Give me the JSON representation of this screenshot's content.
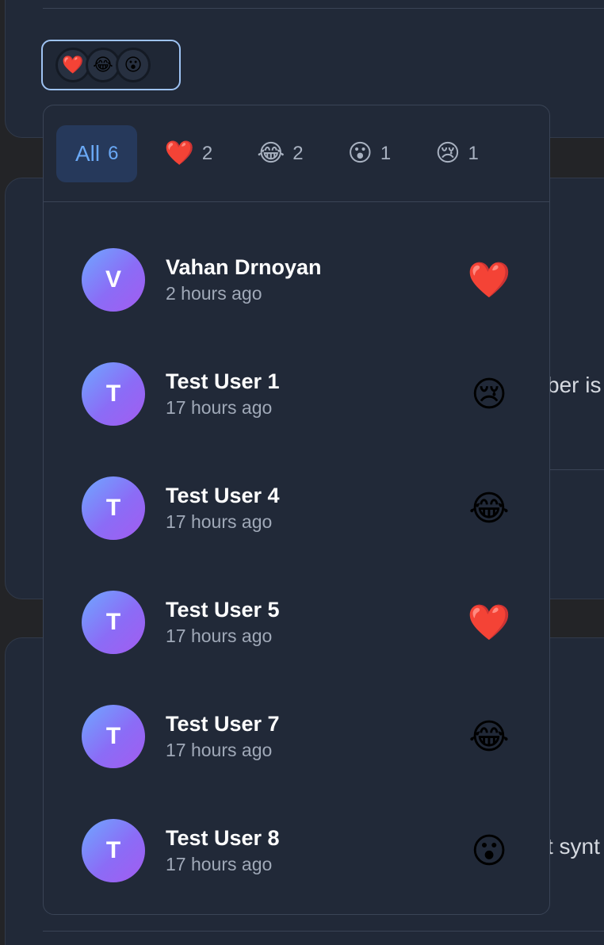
{
  "reaction_pill": {
    "emojis": [
      "❤️",
      "😂",
      "😮"
    ]
  },
  "tabs": [
    {
      "label": "All",
      "count": "6",
      "active": true
    },
    {
      "emoji": "❤️",
      "count": "2",
      "active": false
    },
    {
      "emoji": "😂",
      "count": "2",
      "active": false
    },
    {
      "emoji": "😮",
      "count": "1",
      "active": false
    },
    {
      "emoji": "😢",
      "count": "1",
      "active": false
    }
  ],
  "reactions": [
    {
      "initial": "V",
      "name": "Vahan Drnoyan",
      "time": "2 hours ago",
      "emoji": "❤️"
    },
    {
      "initial": "T",
      "name": "Test User 1",
      "time": "17 hours ago",
      "emoji": "😢"
    },
    {
      "initial": "T",
      "name": "Test User 4",
      "time": "17 hours ago",
      "emoji": "😂"
    },
    {
      "initial": "T",
      "name": "Test User 5",
      "time": "17 hours ago",
      "emoji": "❤️"
    },
    {
      "initial": "T",
      "name": "Test User 7",
      "time": "17 hours ago",
      "emoji": "😂"
    },
    {
      "initial": "T",
      "name": "Test User 8",
      "time": "17 hours ago",
      "emoji": "😮"
    }
  ],
  "background": {
    "text_fragment_1": "ber is",
    "text_fragment_2": "t synt"
  },
  "colors": {
    "accent": "#6aa9f6",
    "active_tab_bg": "#26395b",
    "popover_bg": "#212938",
    "pill_border": "#9ec3f3"
  }
}
